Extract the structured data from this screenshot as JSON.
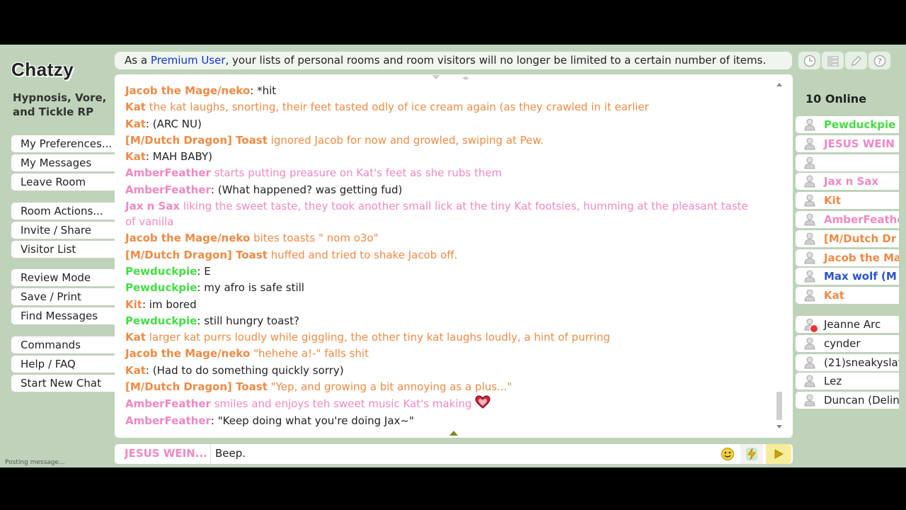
{
  "app": {
    "logo": "Chatzy",
    "room_name": "Hypnosis, Vore, and Tickle RP"
  },
  "banner": {
    "prefix": "As a ",
    "link": "Premium User",
    "suffix": ", your lists of personal rooms and room visitors will no longer be limited to a certain number of items."
  },
  "menu_groups": [
    [
      "My Preferences...",
      "My Messages",
      "Leave Room"
    ],
    [
      "Room Actions...",
      "Invite / Share",
      "Visitor List"
    ],
    [
      "Review Mode",
      "Save / Print",
      "Find Messages"
    ],
    [
      "Commands",
      "Help / FAQ",
      "Start New Chat"
    ]
  ],
  "messages": [
    {
      "name": "Jacob the Mage/neko",
      "sep": ": ",
      "text": "*hit",
      "color": "orange",
      "action": false
    },
    {
      "name": "Kat",
      "sep": " ",
      "text": "the kat laughs, snorting, their feet tasted odly of ice cream again (as they crawled in it earlier",
      "color": "orange",
      "action": true
    },
    {
      "name": "Kat",
      "sep": ": ",
      "text": "(ARC NU)",
      "color": "orange",
      "action": false
    },
    {
      "name": "[M/Dutch Dragon] Toast",
      "sep": " ",
      "text": "ignored Jacob for now and growled, swiping at Pew.",
      "color": "orange",
      "action": true
    },
    {
      "name": "Kat",
      "sep": ": ",
      "text": "MAH BABY)",
      "color": "orange",
      "action": false
    },
    {
      "name": "AmberFeather",
      "sep": " ",
      "text": "starts putting preasure on Kat's feet as she rubs them",
      "color": "pink",
      "action": true
    },
    {
      "name": "AmberFeather",
      "sep": ": ",
      "text": "(What happened? was getting fud)",
      "color": "pink",
      "action": false
    },
    {
      "name": "Jax n Sax",
      "sep": " ",
      "text": "liking the sweet taste, they took another small lick at the tiny Kat footsies, humming at the pleasant taste of vanilla",
      "color": "pink",
      "action": true
    },
    {
      "name": "Jacob the Mage/neko",
      "sep": " ",
      "text": "bites toasts \" nom o3o\"",
      "color": "orange",
      "action": true
    },
    {
      "name": "[M/Dutch Dragon] Toast",
      "sep": " ",
      "text": "huffed and tried to shake Jacob off.",
      "color": "orange",
      "action": true
    },
    {
      "name": "Pewduckpie",
      "sep": ": ",
      "text": "E",
      "color": "green",
      "action": false
    },
    {
      "name": "Pewduckpie",
      "sep": ": ",
      "text": "my afro is safe still",
      "color": "green",
      "action": false
    },
    {
      "name": "Kit",
      "sep": ": ",
      "text": "im bored",
      "color": "orange",
      "action": false
    },
    {
      "name": "Pewduckpie",
      "sep": ": ",
      "text": "still hungry toast?",
      "color": "green",
      "action": false
    },
    {
      "name": "Kat",
      "sep": " ",
      "text": "larger kat purrs loudly while giggling, the other tiny kat laughs loudly, a hint of purring",
      "color": "orange",
      "action": true
    },
    {
      "name": "Jacob the Mage/neko",
      "sep": " ",
      "text": "\"hehehe a!-\" falls shit",
      "color": "orange",
      "action": true
    },
    {
      "name": "Kat",
      "sep": ": ",
      "text": "(Had to do something quickly sorry)",
      "color": "orange",
      "action": false
    },
    {
      "name": "[M/Dutch Dragon] Toast",
      "sep": " ",
      "text": "\"Yep, and growing a bit annoying as a plus...\"",
      "color": "orange",
      "action": true
    },
    {
      "name": "AmberFeather",
      "sep": " ",
      "text": "smiles and enjoys teh sweet music Kat's making",
      "color": "pink",
      "action": true,
      "heart": true
    },
    {
      "name": "AmberFeather",
      "sep": ": ",
      "text": "\"Keep doing what you're doing Jax~\"",
      "color": "pink",
      "action": false
    }
  ],
  "online": {
    "count_label": "10 Online",
    "users": [
      {
        "name": "Pewduckpie",
        "color": "#44dd44"
      },
      {
        "name": "JESUS WEIN",
        "color": "#ee88c3"
      },
      {
        "name": "",
        "color": "#ee88c3"
      },
      {
        "name": "Jax n Sax",
        "color": "#ee88c3"
      },
      {
        "name": "Kit",
        "color": "#ee8a44"
      },
      {
        "name": "AmberFeathe",
        "color": "#ee88c3"
      },
      {
        "name": "[M/Dutch Dr",
        "color": "#ee8a44"
      },
      {
        "name": "Jacob the Ma",
        "color": "#ee8a44"
      },
      {
        "name": "Max wolf (M",
        "color": "#2a55cc"
      },
      {
        "name": "Kat",
        "color": "#ee8a44"
      }
    ]
  },
  "visitors": [
    {
      "name": "Jeanne Arc",
      "blocked": true
    },
    {
      "name": "cynder",
      "blocked": false
    },
    {
      "name": "(21)sneakyslav",
      "blocked": false
    },
    {
      "name": "Lez",
      "blocked": false
    },
    {
      "name": "Duncan (Delin",
      "blocked": false
    }
  ],
  "input": {
    "name": "JESUS WEIN...",
    "value": "Beep."
  },
  "status": "Posting message...",
  "colors": {
    "orange": "#ee8a44",
    "pink": "#ee88c3",
    "green": "#44dd44",
    "link": "#1133cc",
    "panel": "#bfd3ba"
  }
}
